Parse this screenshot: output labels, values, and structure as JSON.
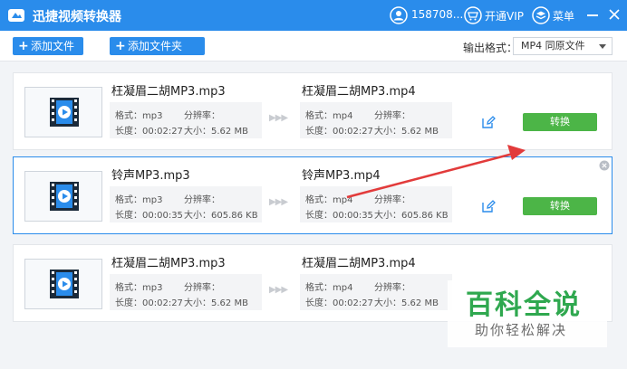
{
  "app": {
    "title": "迅捷视频转换器",
    "user": "158708...",
    "vip": "开通VIP",
    "menu": "菜单"
  },
  "toolbar": {
    "add_file": "添加文件",
    "add_folder": "添加文件夹",
    "format_label": "输出格式：",
    "format_value": "MP4  同原文件"
  },
  "labels": {
    "format": "格式：",
    "resolution": "分辨率：",
    "duration": "长度：",
    "size": "大小：",
    "convert": "转换"
  },
  "rows": [
    {
      "src_name": "枉凝眉二胡MP3.mp3",
      "dst_name": "枉凝眉二胡MP3.mp4",
      "src_format": "mp3",
      "dst_format": "mp4",
      "duration": "00:02:27",
      "size": "5.62 MB"
    },
    {
      "src_name": "铃声MP3.mp3",
      "dst_name": "铃声MP3.mp4",
      "src_format": "mp3",
      "dst_format": "mp4",
      "duration": "00:00:35",
      "size": "605.86 KB"
    },
    {
      "src_name": "枉凝眉二胡MP3.mp3",
      "dst_name": "枉凝眉二胡MP3.mp4",
      "src_format": "mp3",
      "dst_format": "mp4",
      "duration": "00:02:27",
      "size": "5.62 MB"
    }
  ],
  "watermark": {
    "big": "百科全说",
    "small": "助你轻松解决"
  },
  "colors": {
    "accent": "#2a8ceb",
    "convert": "#4cb547",
    "arrow": "#e23b3b"
  }
}
